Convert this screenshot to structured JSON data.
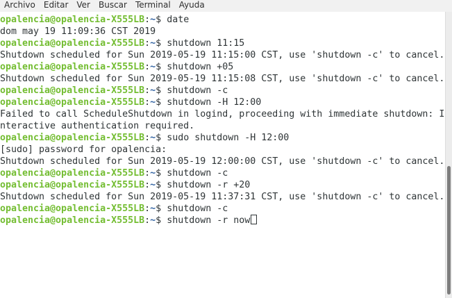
{
  "menu": [
    "Archivo",
    "Editar",
    "Ver",
    "Buscar",
    "Terminal",
    "Ayuda"
  ],
  "prompt": {
    "user_host": "opalencia@opalencia-X555LB",
    "sep": ":",
    "path": "~",
    "symbol": "$ "
  },
  "lines": [
    {
      "type": "cmd",
      "text": "date"
    },
    {
      "type": "out",
      "text": "dom may 19 11:09:36 CST 2019"
    },
    {
      "type": "cmd",
      "text": "shutdown 11:15"
    },
    {
      "type": "out",
      "text": "Shutdown scheduled for Sun 2019-05-19 11:15:00 CST, use 'shutdown -c' to cancel."
    },
    {
      "type": "cmd",
      "text": "shutdown +05"
    },
    {
      "type": "out",
      "text": "Shutdown scheduled for Sun 2019-05-19 11:15:08 CST, use 'shutdown -c' to cancel."
    },
    {
      "type": "cmd",
      "text": "shutdown -c"
    },
    {
      "type": "cmd",
      "text": "shutdown -H 12:00"
    },
    {
      "type": "out",
      "text": "Failed to call ScheduleShutdown in logind, proceeding with immediate shutdown: I"
    },
    {
      "type": "out",
      "text": "nteractive authentication required."
    },
    {
      "type": "cmd",
      "text": "sudo shutdown -H 12:00"
    },
    {
      "type": "out",
      "text": "[sudo] password for opalencia:"
    },
    {
      "type": "out",
      "text": "Shutdown scheduled for Sun 2019-05-19 12:00:00 CST, use 'shutdown -c' to cancel."
    },
    {
      "type": "cmd",
      "text": "shutdown -c"
    },
    {
      "type": "cmd",
      "text": "shutdown -r +20"
    },
    {
      "type": "out",
      "text": "Shutdown scheduled for Sun 2019-05-19 11:37:31 CST, use 'shutdown -c' to cancel."
    },
    {
      "type": "cmd",
      "text": "shutdown -c"
    },
    {
      "type": "cmd",
      "text": "shutdown -r now",
      "cursor": true
    }
  ],
  "scrollbar": {
    "position": 0.55,
    "visible_fraction": 0.45
  },
  "colors": {
    "prompt_user": "#73bd31",
    "prompt_path": "#3465a4",
    "text": "#2e3436",
    "background": "#ffffff"
  }
}
